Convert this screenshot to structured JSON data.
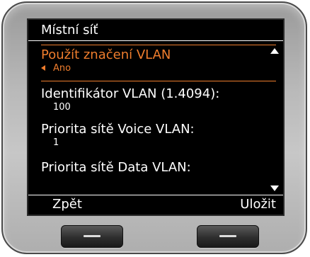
{
  "screen": {
    "title": "Místní síť"
  },
  "menu": {
    "items": [
      {
        "label": "Použít značení VLAN",
        "value": "Ano",
        "selected": true
      },
      {
        "label": "Identifikátor VLAN (1.4094):",
        "value": "100",
        "selected": false
      },
      {
        "label": "Priorita sítě Voice VLAN:",
        "value": "1",
        "selected": false
      },
      {
        "label": "Priorita sítě Data VLAN:",
        "value": "",
        "selected": false
      }
    ]
  },
  "softkeys": {
    "left": "Zpět",
    "right": "Uložit"
  },
  "colors": {
    "highlight": "#ef7d2d",
    "screen_bg": "#000000",
    "text": "#ffffff"
  },
  "icons": {
    "scroll_up": "triangle-up-icon",
    "scroll_down": "triangle-down-icon",
    "value_left": "triangle-left-icon"
  }
}
